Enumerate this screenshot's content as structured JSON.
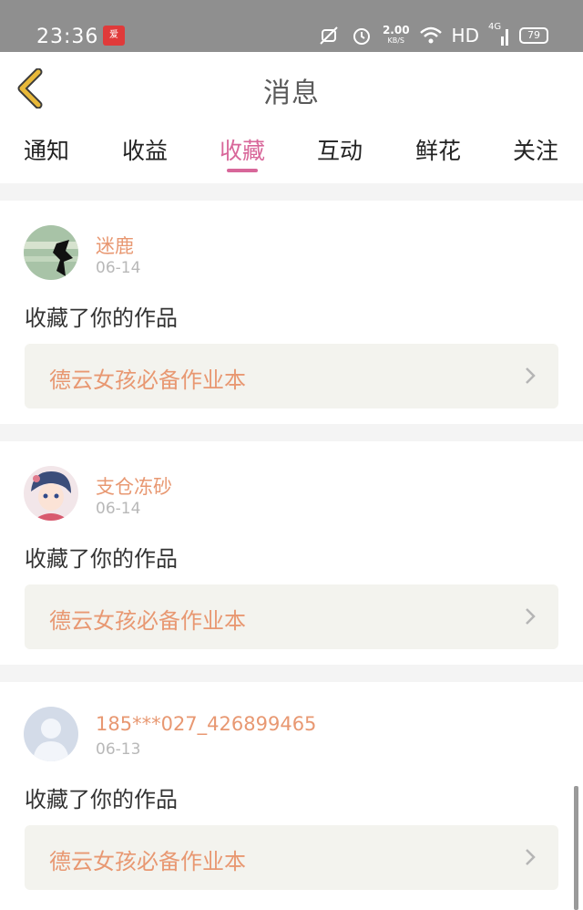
{
  "status_bar": {
    "time": "23:36",
    "app_badge": "爱",
    "speed_value": "2.00",
    "speed_unit": "KB/S",
    "hd_label": "HD",
    "network_label": "4G",
    "battery": "79",
    "icons": [
      "mute-vibrate-icon",
      "alarm-icon",
      "wifi-icon",
      "signal-icon",
      "battery-icon"
    ]
  },
  "header": {
    "title": "消息",
    "back_icon": "chevron-left-icon"
  },
  "tabs": [
    {
      "label": "通知",
      "active": false
    },
    {
      "label": "收益",
      "active": false
    },
    {
      "label": "收藏",
      "active": true
    },
    {
      "label": "互动",
      "active": false
    },
    {
      "label": "鲜花",
      "active": false
    },
    {
      "label": "关注",
      "active": false
    }
  ],
  "notifications": [
    {
      "username": "迷鹿",
      "date": "06-14",
      "action": "收藏了你的作品",
      "work_title": "德云女孩必备作业本",
      "avatar": "avatar-image"
    },
    {
      "username": "支仓冻砂",
      "date": "06-14",
      "action": "收藏了你的作品",
      "work_title": "德云女孩必备作业本",
      "avatar": "avatar-image"
    },
    {
      "username": "185***027_426899465",
      "date": "06-13",
      "action": "收藏了你的作品",
      "work_title": "德云女孩必备作业本",
      "avatar": "default-avatar-icon"
    }
  ],
  "colors": {
    "accent": "#d8679a",
    "username": "#e89872",
    "back_arrow": "#e9b93a",
    "status_bar": "#8f8f8f"
  }
}
